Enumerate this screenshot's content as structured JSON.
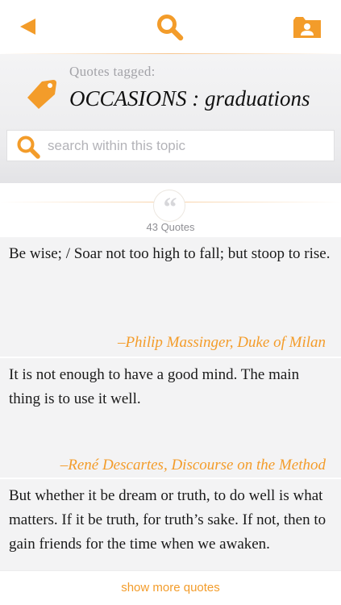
{
  "colors": {
    "accent": "#F39C2A",
    "header_bg": "#ECECEE",
    "quote_bg": "#F3F3F4"
  },
  "toolbar": {
    "back_icon": "back-arrow-icon",
    "search_icon": "search-icon",
    "profile_icon": "profile-folder-icon"
  },
  "header": {
    "tagged_label": "Quotes tagged:",
    "topic_title": "OCCASIONS : graduations",
    "tag_icon": "tag-icon"
  },
  "search": {
    "placeholder": "search within this topic",
    "value": ""
  },
  "summary": {
    "count_label": "43 Quotes",
    "quote_mark": "“"
  },
  "quotes": [
    {
      "text": "Be wise; / Soar not too high to fall; but stoop to rise.",
      "author": "–Philip Massinger, Duke of Milan"
    },
    {
      "text": "It is not enough to have a good mind. The main thing is to use it well.",
      "author": "–René Descartes, Discourse on the Method"
    },
    {
      "text": "But whether it be dream or truth, to do well is what matters. If it be truth, for truth’s sake. If not, then to gain friends for the time when we awaken."
    }
  ],
  "footer": {
    "show_more_label": "show more quotes"
  }
}
